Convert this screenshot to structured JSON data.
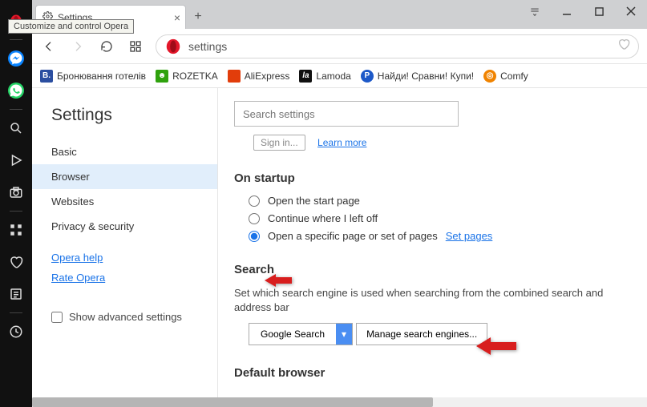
{
  "window": {
    "tooltip": "Customize and control Opera",
    "tab_title": "Settings"
  },
  "address": {
    "url_text": "settings"
  },
  "bookmarks": [
    {
      "label": "Бронювання готелів",
      "bg": "#2b4ea0",
      "letter": "B."
    },
    {
      "label": "ROZETKA",
      "bg": "#2fa20d",
      "letter": "☻"
    },
    {
      "label": "AliExpress",
      "bg": "#e23d0b",
      "letter": ""
    },
    {
      "label": "Lamoda",
      "bg": "#111",
      "letter": "la"
    },
    {
      "label": "Найди! Сравни! Купи!",
      "bg": "#1d59c8",
      "letter": "P"
    },
    {
      "label": "Comfy",
      "bg": "#f08300",
      "letter": "◎"
    }
  ],
  "sidebar": {
    "title": "Settings",
    "items": [
      "Basic",
      "Browser",
      "Websites",
      "Privacy & security"
    ],
    "active_index": 1,
    "help": "Opera help",
    "rate": "Rate Opera",
    "advanced_label": "Show advanced settings"
  },
  "main": {
    "search_placeholder": "Search settings",
    "truncated_button": "Sign in...",
    "truncated_link": "Learn more",
    "startup": {
      "heading": "On startup",
      "opt1": "Open the start page",
      "opt2": "Continue where I left off",
      "opt3": "Open a specific page or set of pages",
      "set_pages": "Set pages"
    },
    "search": {
      "heading": "Search",
      "desc": "Set which search engine is used when searching from the combined search and address bar",
      "selected_engine": "Google Search",
      "manage_btn": "Manage search engines..."
    },
    "default_browser_heading": "Default browser"
  }
}
